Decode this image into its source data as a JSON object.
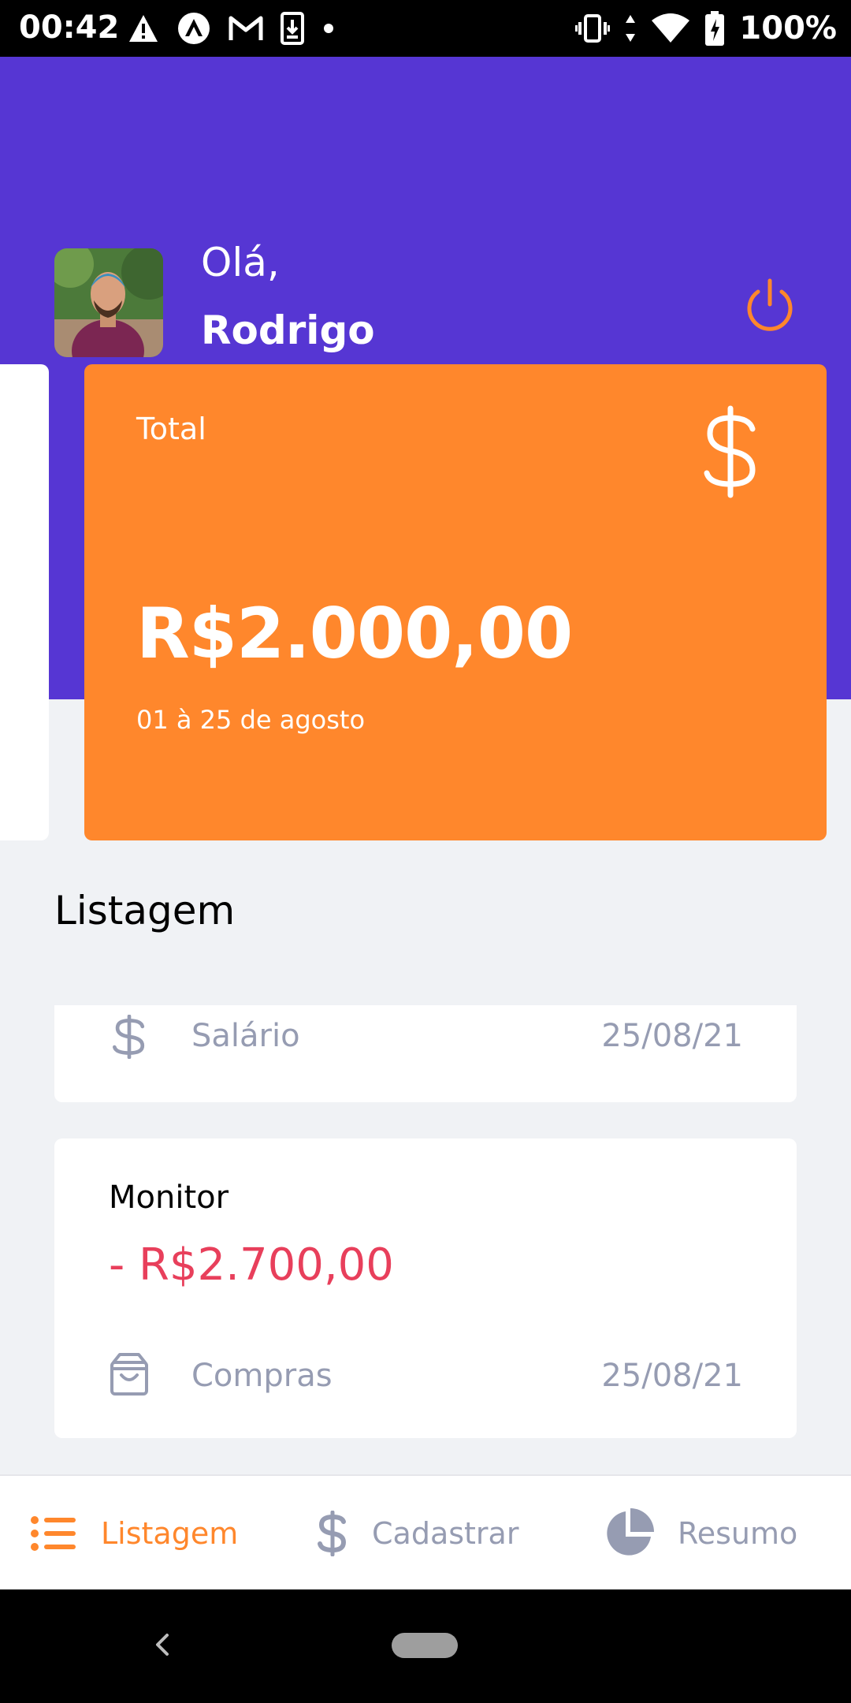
{
  "status_bar": {
    "time": "00:42",
    "battery": "100%",
    "left_icons": [
      "warning-icon",
      "app-icon",
      "gmail-icon",
      "download-icon",
      "dot-icon"
    ],
    "right_icons": [
      "vibrate-icon",
      "wifi-icon",
      "battery-icon"
    ]
  },
  "header": {
    "greeting": "Olá,",
    "user_name": "Rodrigo",
    "logout_icon": "power-icon",
    "avatar_icon": "profile-photo"
  },
  "highlight_card": {
    "title": "Total",
    "icon": "dollar-icon",
    "amount": "R$2.000,00",
    "period": "01 à 25 de agosto"
  },
  "list": {
    "title": "Listagem",
    "transactions": [
      {
        "category": "Salário",
        "category_icon": "dollar-icon",
        "date": "25/08/21"
      },
      {
        "title": "Monitor",
        "amount": "- R$2.700,00",
        "category": "Compras",
        "category_icon": "shopping-bag-icon",
        "date": "25/08/21"
      }
    ]
  },
  "tab_bar": {
    "tabs": [
      {
        "label": "Listagem",
        "icon": "list-icon",
        "active": true
      },
      {
        "label": "Cadastrar",
        "icon": "dollar-icon",
        "active": false
      },
      {
        "label": "Resumo",
        "icon": "pie-chart-icon",
        "active": false
      }
    ]
  },
  "colors": {
    "primary": "#5636d3",
    "secondary": "#ff872c",
    "attention": "#e83f5b",
    "text_light": "#969cb2",
    "background": "#f0f2f5"
  }
}
